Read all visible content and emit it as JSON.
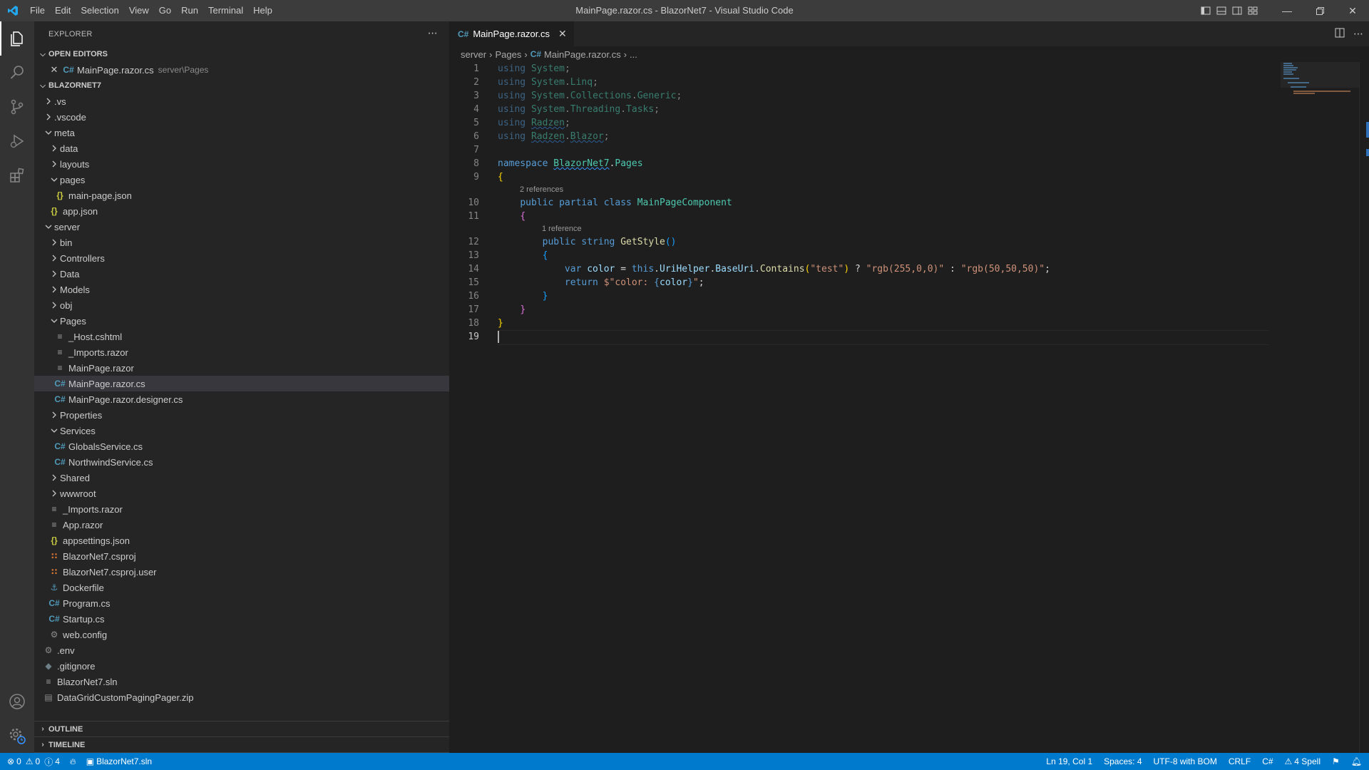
{
  "window": {
    "title": "MainPage.razor.cs - BlazorNet7 - Visual Studio Code",
    "menu": [
      "File",
      "Edit",
      "Selection",
      "View",
      "Go",
      "Run",
      "Terminal",
      "Help"
    ]
  },
  "activity_bar": {
    "items": [
      "explorer-icon",
      "search-icon",
      "source-control-icon",
      "run-debug-icon",
      "extensions-icon"
    ],
    "bottom": [
      "accounts-icon",
      "manage-gear-icon"
    ]
  },
  "sidebar": {
    "title": "EXPLORER",
    "open_editors": {
      "label": "OPEN EDITORS",
      "items": [
        {
          "name": "MainPage.razor.cs",
          "desc": "server\\Pages"
        }
      ]
    },
    "project": {
      "label": "BLAZORNET7",
      "tree": [
        {
          "name": ".vs",
          "depth": 1,
          "kind": "folder",
          "open": false
        },
        {
          "name": ".vscode",
          "depth": 1,
          "kind": "folder",
          "open": false
        },
        {
          "name": "meta",
          "depth": 1,
          "kind": "folder",
          "open": true
        },
        {
          "name": "data",
          "depth": 2,
          "kind": "folder",
          "open": false
        },
        {
          "name": "layouts",
          "depth": 2,
          "kind": "folder",
          "open": false
        },
        {
          "name": "pages",
          "depth": 2,
          "kind": "folder",
          "open": true
        },
        {
          "name": "main-page.json",
          "depth": 3,
          "kind": "json"
        },
        {
          "name": "app.json",
          "depth": 2,
          "kind": "json"
        },
        {
          "name": "server",
          "depth": 1,
          "kind": "folder",
          "open": true
        },
        {
          "name": "bin",
          "depth": 2,
          "kind": "folder",
          "open": false
        },
        {
          "name": "Controllers",
          "depth": 2,
          "kind": "folder",
          "open": false
        },
        {
          "name": "Data",
          "depth": 2,
          "kind": "folder",
          "open": false
        },
        {
          "name": "Models",
          "depth": 2,
          "kind": "folder",
          "open": false
        },
        {
          "name": "obj",
          "depth": 2,
          "kind": "folder",
          "open": false
        },
        {
          "name": "Pages",
          "depth": 2,
          "kind": "folder",
          "open": true
        },
        {
          "name": "_Host.cshtml",
          "depth": 3,
          "kind": "lines"
        },
        {
          "name": "_Imports.razor",
          "depth": 3,
          "kind": "lines"
        },
        {
          "name": "MainPage.razor",
          "depth": 3,
          "kind": "lines"
        },
        {
          "name": "MainPage.razor.cs",
          "depth": 3,
          "kind": "cs",
          "selected": true
        },
        {
          "name": "MainPage.razor.designer.cs",
          "depth": 3,
          "kind": "cs"
        },
        {
          "name": "Properties",
          "depth": 2,
          "kind": "folder",
          "open": false
        },
        {
          "name": "Services",
          "depth": 2,
          "kind": "folder",
          "open": true
        },
        {
          "name": "GlobalsService.cs",
          "depth": 3,
          "kind": "cs"
        },
        {
          "name": "NorthwindService.cs",
          "depth": 3,
          "kind": "cs"
        },
        {
          "name": "Shared",
          "depth": 2,
          "kind": "folder",
          "open": false
        },
        {
          "name": "wwwroot",
          "depth": 2,
          "kind": "folder",
          "open": false
        },
        {
          "name": "_Imports.razor",
          "depth": 2,
          "kind": "lines"
        },
        {
          "name": "App.razor",
          "depth": 2,
          "kind": "lines"
        },
        {
          "name": "appsettings.json",
          "depth": 2,
          "kind": "json"
        },
        {
          "name": "BlazorNet7.csproj",
          "depth": 2,
          "kind": "rss"
        },
        {
          "name": "BlazorNet7.csproj.user",
          "depth": 2,
          "kind": "rss"
        },
        {
          "name": "Dockerfile",
          "depth": 2,
          "kind": "docker"
        },
        {
          "name": "Program.cs",
          "depth": 2,
          "kind": "cs"
        },
        {
          "name": "Startup.cs",
          "depth": 2,
          "kind": "cs"
        },
        {
          "name": "web.config",
          "depth": 2,
          "kind": "gear"
        },
        {
          "name": ".env",
          "depth": 1,
          "kind": "gear"
        },
        {
          "name": ".gitignore",
          "depth": 1,
          "kind": "git"
        },
        {
          "name": "BlazorNet7.sln",
          "depth": 1,
          "kind": "lines"
        },
        {
          "name": "DataGridCustomPagingPager.zip",
          "depth": 1,
          "kind": "zip"
        }
      ]
    },
    "outline_label": "OUTLINE",
    "timeline_label": "TIMELINE"
  },
  "editor": {
    "tab": {
      "label": "MainPage.razor.cs"
    },
    "breadcrumb": [
      "server",
      "Pages",
      "MainPage.razor.cs",
      "..."
    ],
    "codelens": {
      "class_refs": "2 references",
      "method_refs": "1 reference"
    },
    "line_numbers": [
      "1",
      "2",
      "3",
      "4",
      "5",
      "6",
      "7",
      "8",
      "9",
      "10",
      "11",
      "12",
      "13",
      "14",
      "15",
      "16",
      "17",
      "18",
      "19"
    ]
  },
  "statusbar": {
    "errors": "0",
    "warnings": "0",
    "infos": "4",
    "solution": "BlazorNet7.sln",
    "position": "Ln 19, Col 1",
    "spaces": "Spaces: 4",
    "encoding": "UTF-8 with BOM",
    "eol": "CRLF",
    "language": "C#",
    "spell": "4 Spell",
    "colors": {
      "background": "#007acc"
    }
  }
}
